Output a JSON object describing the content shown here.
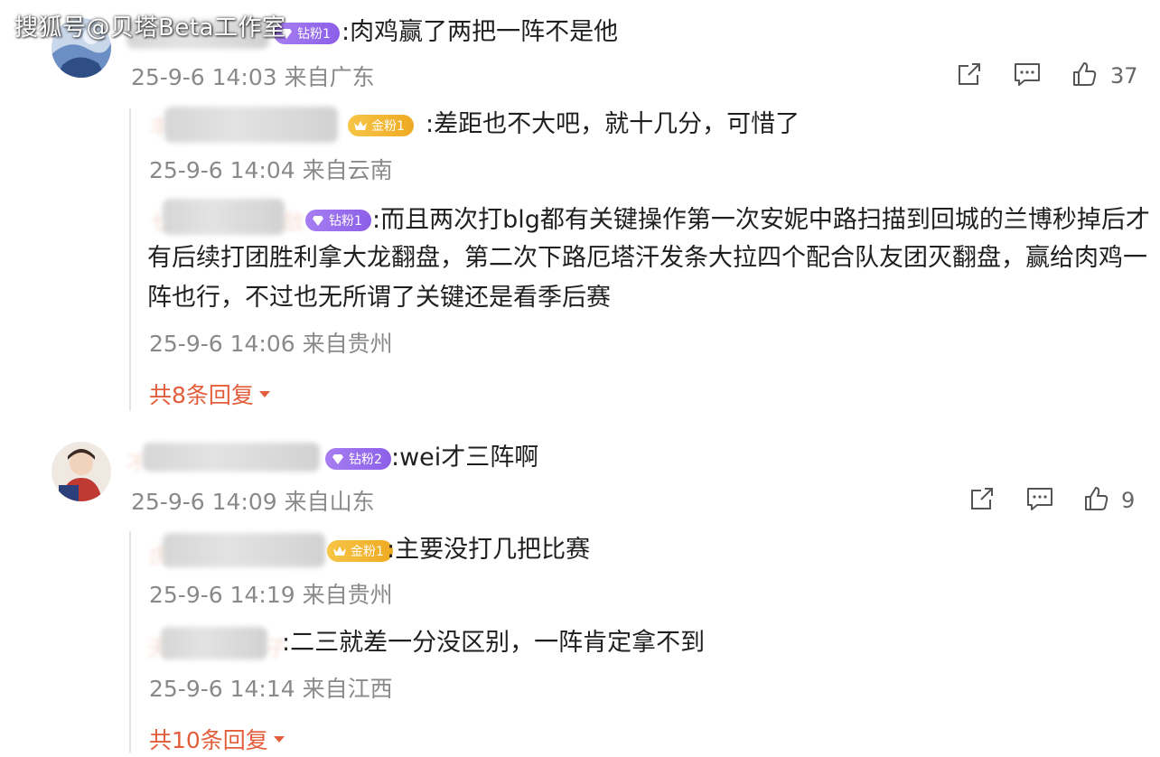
{
  "watermark": "搜狐号@贝塔Beta工作室",
  "comments": [
    {
      "badge": "钻粉1",
      "text": ":肉鸡赢了两把一阵不是他",
      "time": "25-9-6 14:03 来自广东",
      "likes": "37",
      "replies": [
        {
          "badge": "金粉1",
          "text": ":差距也不大吧，就十几分，可惜了",
          "time": "25-9-6 14:04 来自云南"
        },
        {
          "badge": "钻粉1",
          "text_lines": [
            ":而且两次打blg都有关键操作第一次安妮中路扫描到回城的兰博秒掉后才",
            "有后续打团胜利拿大龙翻盘，第二次下路厄塔汗发条大拉四个配合队友团灭翻盘，赢给肉鸡一",
            "阵也行，不过也无所谓了关键还是看季后赛"
          ],
          "time": "25-9-6 14:06 来自贵州"
        }
      ],
      "more_replies": "共8条回复"
    },
    {
      "badge": "钻粉2",
      "text": ":wei才三阵啊",
      "time": "25-9-6 14:09 来自山东",
      "likes": "9",
      "replies": [
        {
          "badge": "金粉1",
          "text": ":主要没打几把比赛",
          "time": "25-9-6 14:19 来自贵州"
        },
        {
          "text": ":二三就差一分没区别，一阵肯定拿不到",
          "time": "25-9-6 14:14 来自江西"
        }
      ],
      "more_replies": "共10条回复"
    }
  ],
  "blurred_name_fragments": [
    "丰",
    "七",
    "敌",
    "不",
    "虎",
    "天",
    "子"
  ],
  "icons": [
    "share-icon",
    "comment-icon",
    "thumbs-up-icon",
    "caret-down-icon",
    "diamond-icon",
    "crown-icon"
  ],
  "colors": {
    "accent": "#e35d3b",
    "meta_text": "#8a8a8a",
    "diamond_badge": "#9a6ef0",
    "gold_badge": "#f2b430"
  }
}
